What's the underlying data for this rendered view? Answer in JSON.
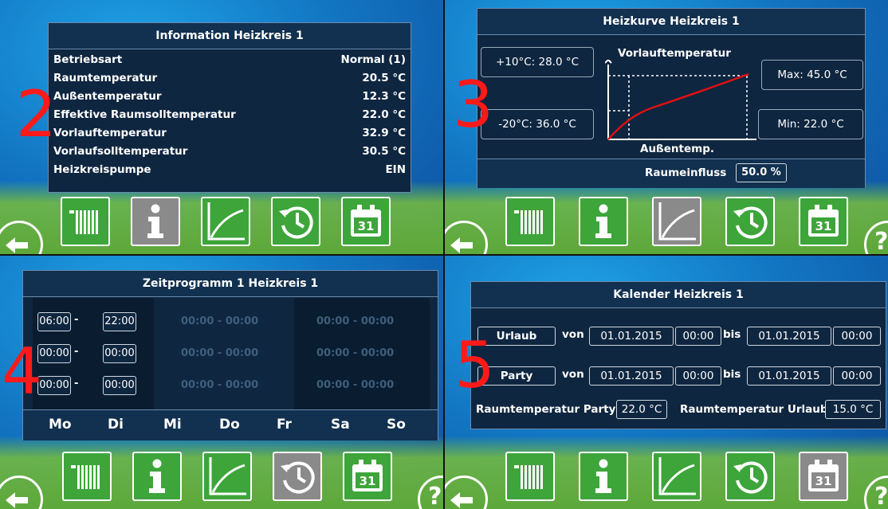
{
  "colors": {
    "accent_green": "#3da53a",
    "number_red": "#ff1a1a",
    "curve_red": "#e01010",
    "panel_bg": "#0f2640"
  },
  "icons": [
    "radiator-icon",
    "info-icon",
    "curve-icon",
    "clock-icon",
    "calendar-icon"
  ],
  "calendar_day": "31",
  "help_glyph": "?",
  "info": {
    "number": "2",
    "title": "Information Heizkreis 1",
    "rows": [
      {
        "label": "Betriebsart",
        "value": "Normal (1)"
      },
      {
        "label": "Raumtemperatur",
        "value": "20.5 °C"
      },
      {
        "label": "Außentemperatur",
        "value": "12.3 °C"
      },
      {
        "label": "Effektive Raumsolltemperatur",
        "value": "22.0 °C"
      },
      {
        "label": "Vorlauftemperatur",
        "value": "32.9 °C"
      },
      {
        "label": "Vorlaufsolltemperatur",
        "value": "30.5 °C"
      },
      {
        "label": "Heizkreispumpe",
        "value": "EIN"
      }
    ]
  },
  "curve": {
    "number": "3",
    "title": "Heizkurve Heizkreis 1",
    "y_label": "Vorlauftemperatur",
    "x_label": "Außentemp.",
    "plus10": "+10°C: 28.0 °C",
    "minus20": "-20°C: 36.0 °C",
    "max": "Max: 45.0 °C",
    "min": "Min:  22.0 °C",
    "raumeinfluss_label": "Raumeinfluss",
    "raumeinfluss_value": "50.0 %"
  },
  "schedule": {
    "number": "4",
    "title": "Zeitprogramm 1 Heizkreis 1",
    "active": [
      [
        "06:00",
        "22:00"
      ],
      [
        "00:00",
        "00:00"
      ],
      [
        "00:00",
        "00:00"
      ]
    ],
    "inactive": "00:00  -  00:00",
    "dash": "-",
    "days": [
      "Mo",
      "Di",
      "Mi",
      "Do",
      "Fr",
      "Sa",
      "So"
    ]
  },
  "calendar": {
    "number": "5",
    "title": "Kalender Heizkreis 1",
    "von": "von",
    "bis": "bis",
    "rows": [
      {
        "button": "Urlaub",
        "from_date": "01.01.2015",
        "from_time": "00:00",
        "to_date": "01.01.2015",
        "to_time": "00:00"
      },
      {
        "button": "Party",
        "from_date": "01.01.2015",
        "from_time": "00:00",
        "to_date": "01.01.2015",
        "to_time": "00:00"
      }
    ],
    "party_temp_label": "Raumtemperatur Party",
    "party_temp_value": "22.0 °C",
    "urlaub_temp_label": "Raumtemperatur Urlaub",
    "urlaub_temp_value": "15.0 °C"
  }
}
